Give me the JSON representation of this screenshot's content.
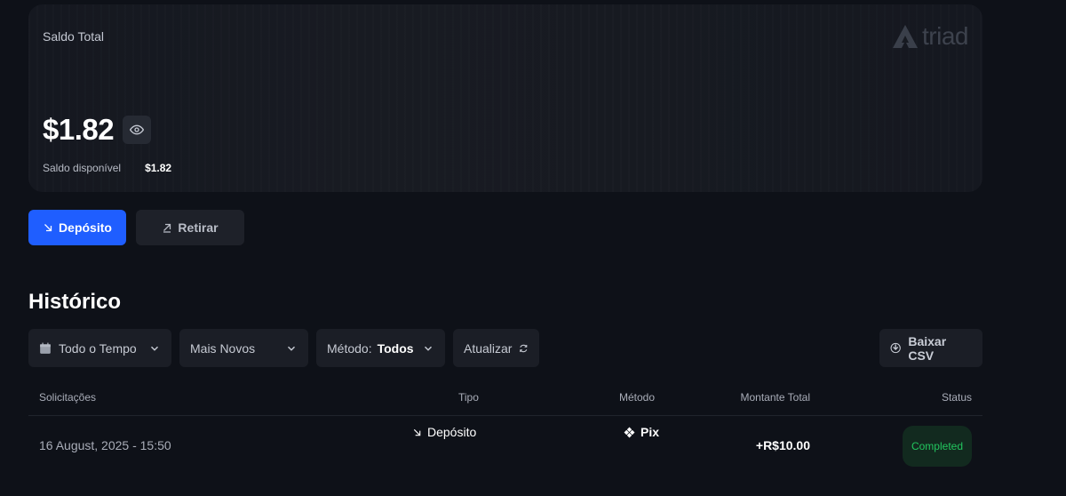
{
  "balance": {
    "label": "Saldo Total",
    "brand": "triad",
    "amount": "$1.82",
    "available_label": "Saldo disponível",
    "available_value": "$1.82"
  },
  "actions": {
    "deposit_label": "Depósito",
    "withdraw_label": "Retirar"
  },
  "history": {
    "title": "Histórico",
    "filters": {
      "time": "Todo o Tempo",
      "sort": "Mais Novos",
      "method_label": "Método:",
      "method_value": "Todos",
      "refresh": "Atualizar",
      "csv": "Baixar CSV"
    },
    "columns": {
      "requests": "Solicitações",
      "type": "Tipo",
      "method": "Método",
      "total": "Montante Total",
      "status": "Status"
    },
    "rows": [
      {
        "date": "16 August, 2025 - 15:50",
        "type": "Depósito",
        "method": "Pix",
        "total": "+R$10.00",
        "status": "Completed"
      }
    ]
  },
  "colors": {
    "background": "#0e1118",
    "accent": "#1f5eff",
    "status_completed": "#22c55e"
  },
  "icons": {
    "eye": "eye-icon",
    "deposit": "arrow-down-right-icon",
    "withdraw": "arrow-up-right-icon",
    "calendar": "calendar-icon",
    "chevron": "chevron-down-icon",
    "refresh": "refresh-icon",
    "download": "download-icon",
    "pix": "pix-icon"
  }
}
